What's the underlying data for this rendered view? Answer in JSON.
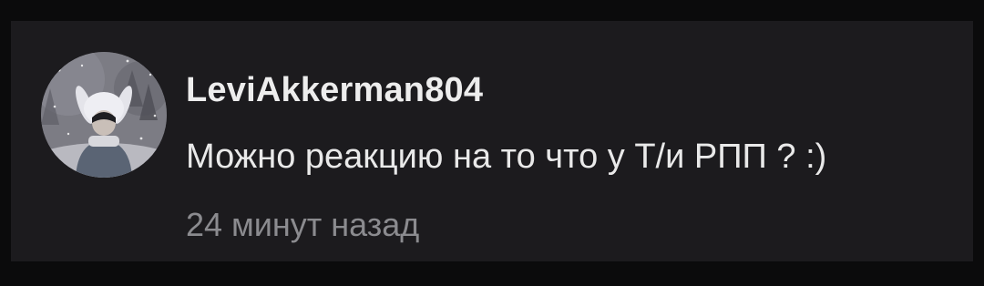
{
  "comment": {
    "author": "LeviAkkerman804",
    "text": "Можно реакцию на то что у Т/и РПП ? :)",
    "time": "24 минут назад"
  },
  "colors": {
    "background": "#0b0b0c",
    "card": "#1c1b1e",
    "author_text": "#ededed",
    "comment_text": "#e9e9e9",
    "time_text": "#8b8b8f"
  }
}
